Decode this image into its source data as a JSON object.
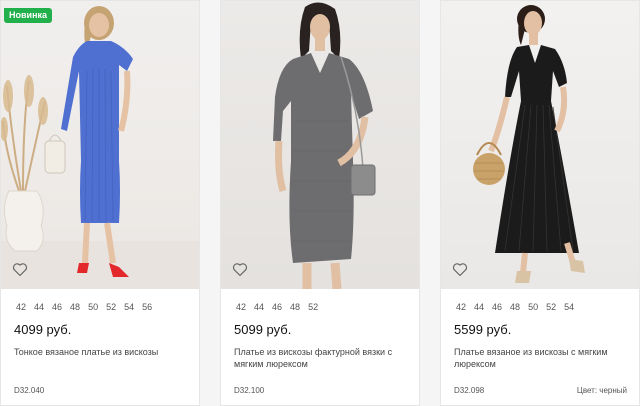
{
  "products": [
    {
      "badge": "Новинка",
      "sizes": [
        "42",
        "44",
        "46",
        "48",
        "50",
        "52",
        "54",
        "56"
      ],
      "price": "4099 руб.",
      "title": "Тонкое вязаное платье из вискозы",
      "code": "D32.040",
      "color_label": "",
      "dress_color": "#4f6fd1",
      "favorite_icon": "heart-outline-icon"
    },
    {
      "badge": "",
      "sizes": [
        "42",
        "44",
        "46",
        "48",
        "52"
      ],
      "price": "5099 руб.",
      "title": "Платье из вискозы фактурной вязки с мягким люрексом",
      "code": "D32.100",
      "color_label": "",
      "dress_color": "#6d6d6f",
      "favorite_icon": "heart-outline-icon"
    },
    {
      "badge": "",
      "sizes": [
        "42",
        "44",
        "46",
        "48",
        "50",
        "52",
        "54"
      ],
      "price": "5599 руб.",
      "title": "Платье вязаное из вискозы с мягким люрексом",
      "code": "D32.098",
      "color_label": "Цвет: черный",
      "dress_color": "#1b1b1b",
      "favorite_icon": "heart-outline-icon"
    }
  ]
}
